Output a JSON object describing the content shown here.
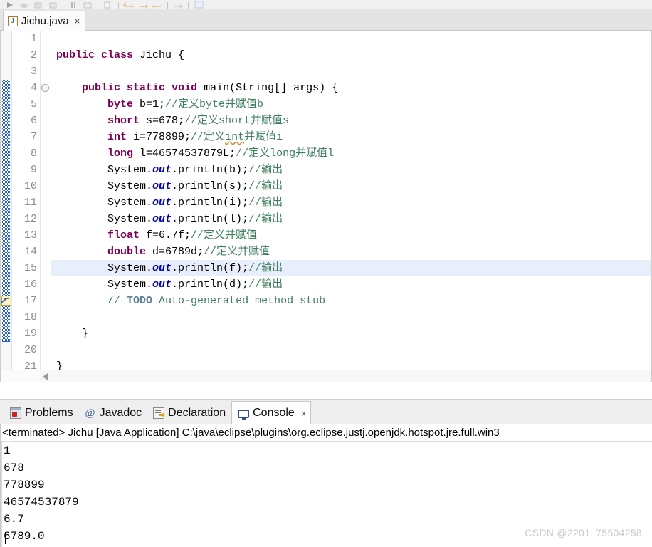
{
  "toolbar": {
    "icons": [
      "run-icon",
      "debug-icon",
      "coverage-icon",
      "external-tools-icon",
      "new-icon",
      "pause-icon",
      "resume-icon",
      "skip-breakpoints-icon",
      "back-icon",
      "forward-icon",
      "undo-icon",
      "redo-icon",
      "next-annotation-icon",
      "perspective-icon"
    ]
  },
  "editor_tab": {
    "icon": "java-file-icon",
    "label": "Jichu.java",
    "close": "×"
  },
  "editor": {
    "current_line": 15,
    "change_bar_from": 4,
    "change_bar_to": 19,
    "fold_line": 4,
    "task_marker_line": 17,
    "colors": {
      "keyword": "#7f0055",
      "comment": "#3f7f5f",
      "todo_tag": "#5f7f9f",
      "static_field": "#0000c0",
      "current_line_bg": "#e8eefb",
      "line_number": "#8d8d8d"
    },
    "lines": [
      {
        "n": 1,
        "tokens": []
      },
      {
        "n": 2,
        "tokens": [
          {
            "t": "public",
            "s": "k"
          },
          {
            "t": " "
          },
          {
            "t": "class",
            "s": "k"
          },
          {
            "t": " Jichu {"
          }
        ]
      },
      {
        "n": 3,
        "tokens": []
      },
      {
        "n": 4,
        "tokens": [
          {
            "t": "    "
          },
          {
            "t": "public",
            "s": "k"
          },
          {
            "t": " "
          },
          {
            "t": "static",
            "s": "k"
          },
          {
            "t": " "
          },
          {
            "t": "void",
            "s": "k"
          },
          {
            "t": " main(String[] args) {"
          }
        ]
      },
      {
        "n": 5,
        "tokens": [
          {
            "t": "        "
          },
          {
            "t": "byte",
            "s": "k"
          },
          {
            "t": " b=1;"
          },
          {
            "t": "//定义byte并赋值b",
            "s": "c"
          }
        ]
      },
      {
        "n": 6,
        "tokens": [
          {
            "t": "        "
          },
          {
            "t": "short",
            "s": "k"
          },
          {
            "t": " s=678;"
          },
          {
            "t": "//定义short并赋值s",
            "s": "c"
          }
        ]
      },
      {
        "n": 7,
        "tokens": [
          {
            "t": "        "
          },
          {
            "t": "int",
            "s": "k"
          },
          {
            "t": " i=778899;"
          },
          {
            "t": "//定义",
            "s": "c"
          },
          {
            "t": "int",
            "s": "c warn"
          },
          {
            "t": "并赋值i",
            "s": "c"
          }
        ]
      },
      {
        "n": 8,
        "tokens": [
          {
            "t": "        "
          },
          {
            "t": "long",
            "s": "k"
          },
          {
            "t": " l=46574537879L;"
          },
          {
            "t": "//定义long并赋值l",
            "s": "c"
          }
        ]
      },
      {
        "n": 9,
        "tokens": [
          {
            "t": "        System."
          },
          {
            "t": "out",
            "s": "fi"
          },
          {
            "t": ".println(b);"
          },
          {
            "t": "//输出",
            "s": "c"
          }
        ]
      },
      {
        "n": 10,
        "tokens": [
          {
            "t": "        System."
          },
          {
            "t": "out",
            "s": "fi"
          },
          {
            "t": ".println(s);"
          },
          {
            "t": "//输出",
            "s": "c"
          }
        ]
      },
      {
        "n": 11,
        "tokens": [
          {
            "t": "        System."
          },
          {
            "t": "out",
            "s": "fi"
          },
          {
            "t": ".println(i);"
          },
          {
            "t": "//输出",
            "s": "c"
          }
        ]
      },
      {
        "n": 12,
        "tokens": [
          {
            "t": "        System."
          },
          {
            "t": "out",
            "s": "fi"
          },
          {
            "t": ".println(l);"
          },
          {
            "t": "//输出",
            "s": "c"
          }
        ]
      },
      {
        "n": 13,
        "tokens": [
          {
            "t": "        "
          },
          {
            "t": "float",
            "s": "k"
          },
          {
            "t": " f=6.7f;"
          },
          {
            "t": "//定义并赋值",
            "s": "c"
          }
        ]
      },
      {
        "n": 14,
        "tokens": [
          {
            "t": "        "
          },
          {
            "t": "double",
            "s": "k"
          },
          {
            "t": " d=6789d;"
          },
          {
            "t": "//定义并赋值",
            "s": "c"
          }
        ]
      },
      {
        "n": 15,
        "tokens": [
          {
            "t": "        System."
          },
          {
            "t": "out",
            "s": "fi"
          },
          {
            "t": ".println(f);"
          },
          {
            "t": "//输出",
            "s": "c"
          }
        ]
      },
      {
        "n": 16,
        "tokens": [
          {
            "t": "        System."
          },
          {
            "t": "out",
            "s": "fi"
          },
          {
            "t": ".println(d);"
          },
          {
            "t": "//输出",
            "s": "c"
          }
        ]
      },
      {
        "n": 17,
        "tokens": [
          {
            "t": "        "
          },
          {
            "t": "// ",
            "s": "c"
          },
          {
            "t": "TODO",
            "s": "td"
          },
          {
            "t": " Auto-generated method stub",
            "s": "c"
          }
        ]
      },
      {
        "n": 18,
        "tokens": []
      },
      {
        "n": 19,
        "tokens": [
          {
            "t": "    }"
          }
        ]
      },
      {
        "n": 20,
        "tokens": []
      },
      {
        "n": 21,
        "tokens": [
          {
            "t": "}"
          }
        ]
      }
    ]
  },
  "view_tabs": [
    {
      "label": "Problems",
      "icon": "problems-icon",
      "active": false
    },
    {
      "label": "Javadoc",
      "icon": "javadoc-at-icon",
      "active": false
    },
    {
      "label": "Declaration",
      "icon": "declaration-icon",
      "active": false
    },
    {
      "label": "Console",
      "icon": "console-icon",
      "active": true,
      "close": "×"
    }
  ],
  "console": {
    "header": "<terminated> Jichu [Java Application] C:\\java\\eclipse\\plugins\\org.eclipse.justj.openjdk.hotspot.jre.full.win3",
    "output": [
      "1",
      "678",
      "778899",
      "46574537879",
      "6.7",
      "6789.0"
    ]
  },
  "watermark": "CSDN @2201_75504258"
}
